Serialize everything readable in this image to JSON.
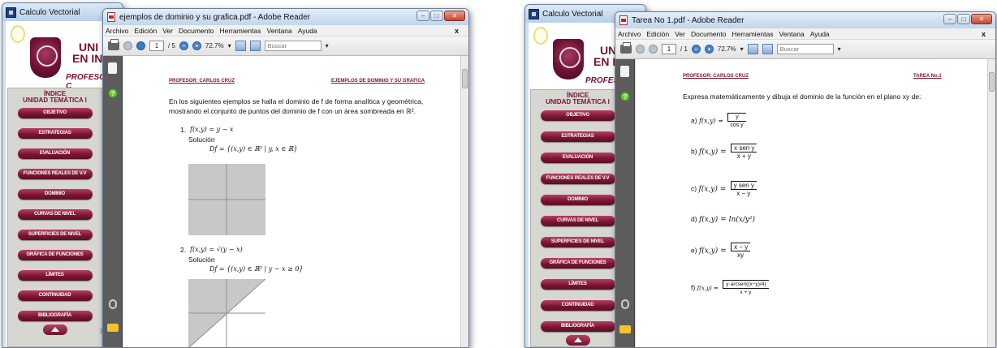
{
  "left": {
    "bg_window": {
      "title": "Calculo Vectorial",
      "banner_line1": "UNI",
      "banner_line2": "EN IN",
      "profesor": "PROFESOR: C",
      "menu_heading_1": "ÍNDICE",
      "menu_heading_2": "UNIDAD TEMÁTICA I",
      "menu_items": [
        "OBJETIVO",
        "ESTRATEGIAS",
        "EVALUACIÓN",
        "FUNCIONES REALES DE V.V",
        "DOMINIO",
        "CURVAS DE NIVEL",
        "SUPERFICIES DE NIVEL",
        "GRÁFICA DE FUNCIONES",
        "LÍMITES",
        "CONTINUIDAD",
        "BIBLIOGRAFÍA"
      ],
      "link_fragment": "XX"
    },
    "reader": {
      "title": "ejemplos de dominio y su grafica.pdf - Adobe Reader",
      "menu": [
        "Archivo",
        "Edición",
        "Ver",
        "Documento",
        "Herramientas",
        "Ventana",
        "Ayuda"
      ],
      "page": "1",
      "page_total": "/ 5",
      "zoom": "72.7%",
      "search_placeholder": "Buscar",
      "doc": {
        "header_left": "PROFESOR: CARLOS CRUZ",
        "header_right": "EJEMPLOS DE DOMINIO Y SU GRAFICA",
        "intro_1": "En los siguientes ejemplos se halla el dominio de f de forma analítica y geométrica,",
        "intro_2": "mostrando el conjunto de puntos del dominio de f con un área sombreada en ℝ².",
        "ex1_num": "1.",
        "ex1_func": "f(x,y) = y − x",
        "ex1_sol": "Solución",
        "ex1_dom": "Dƒ = {(x,y) ∈ ℝ² | y, x ∈ ℝ}",
        "ex2_num": "2.",
        "ex2_func": "f(x,y) = √(y − x)",
        "ex2_sol": "Solución",
        "ex2_dom": "Dƒ = {(x,y) ∈ ℝ² | y − x ≥ 0}"
      }
    }
  },
  "right": {
    "bg_window": {
      "title": "Calculo Vectorial",
      "banner_line1": "UNI",
      "banner_line2": "EN I",
      "profesor": "PROFESOR:",
      "menu_heading_1": "ÍNDICE",
      "menu_heading_2": "UNIDAD TEMÁTICA I",
      "menu_items": [
        "OBJETIVO",
        "ESTRATEGIAS",
        "EVALUACIÓN",
        "FUNCIONES REALES DE V.V",
        "DOMINIO",
        "CURVAS DE NIVEL",
        "SUPERFICIES DE NIVEL",
        "GRÁFICA DE FUNCIONES",
        "LÍMITES",
        "CONTINUIDAD",
        "BIBLIOGRAFÍA"
      ]
    },
    "reader": {
      "title": "Tarea No 1.pdf - Adobe Reader",
      "menu": [
        "Archivo",
        "Edición",
        "Ver",
        "Documento",
        "Herramientas",
        "Ventana",
        "Ayuda"
      ],
      "page": "1",
      "page_total": "/ 1",
      "zoom": "72.7%",
      "search_placeholder": "Buscar",
      "doc": {
        "header_left": "PROFESOR: CARLOS CRUZ",
        "header_right": "TAREA No.1",
        "intro": "Expresa matemáticamente y dibuja el dominio de la función en el plano xy de:",
        "items": [
          {
            "label": "a)",
            "lhs": "f(x,y) =",
            "num": "y",
            "den": "cos y"
          },
          {
            "label": "b)",
            "lhs": "f(x,y) =",
            "num": "x sen y",
            "den": "x + y"
          },
          {
            "label": "c)",
            "lhs": "f(x,y) =",
            "num": "y sen y",
            "den": "x − y"
          },
          {
            "label": "d)",
            "lhs": "f(x,y) = ln(x/y²)"
          },
          {
            "label": "e)",
            "lhs": "f(x,y) =",
            "num": "x − y",
            "den": "xy"
          },
          {
            "label": "f)",
            "lhs": "f(x,y) =",
            "num": "y·arcsen((x−y)/4)",
            "den": "x + y"
          }
        ]
      }
    }
  }
}
